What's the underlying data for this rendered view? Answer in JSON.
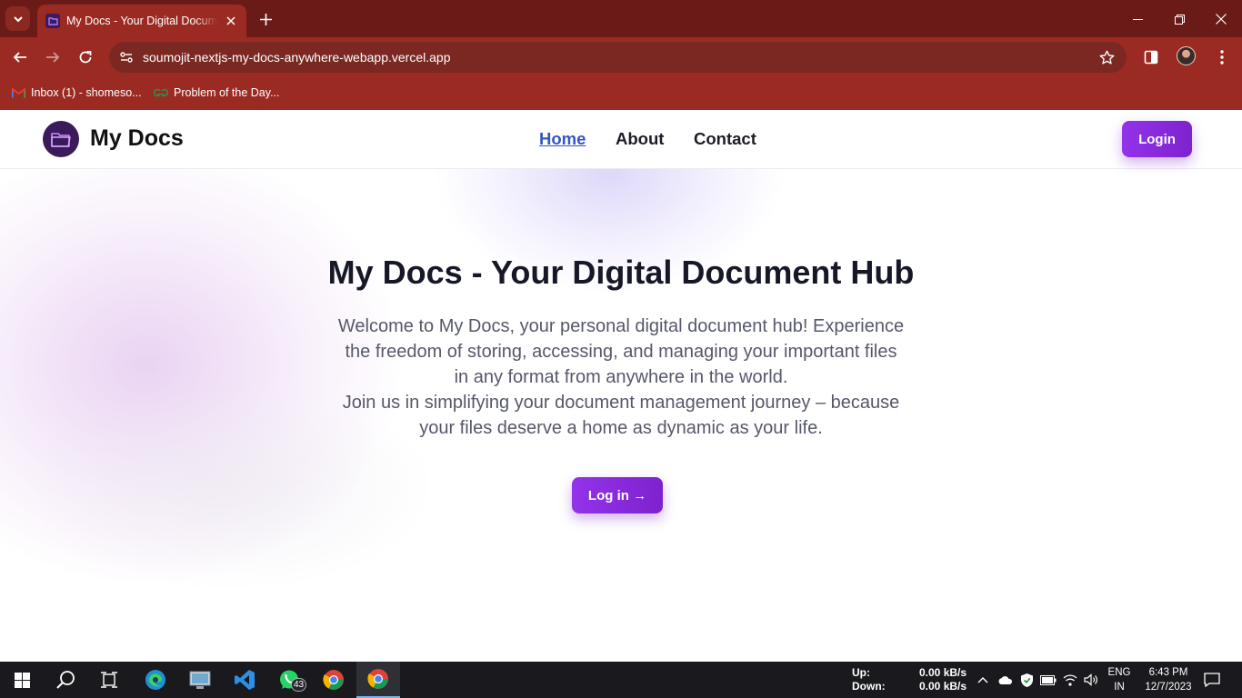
{
  "browser": {
    "tab_title": "My Docs - Your Digital Document Hub",
    "url": "soumojit-nextjs-my-docs-anywhere-webapp.vercel.app",
    "bookmarks": [
      {
        "label": "Inbox (1) - shomeso...",
        "icon": "gmail-icon"
      },
      {
        "label": "Problem of the Day...",
        "icon": "gfg-icon"
      }
    ]
  },
  "site": {
    "brand": "My Docs",
    "nav": {
      "home": "Home",
      "about": "About",
      "contact": "Contact"
    },
    "login_label": "Login",
    "accent_color": "#9333ea"
  },
  "hero": {
    "title": "My Docs - Your Digital Document Hub",
    "paragraph_lines": [
      "Welcome to My Docs, your personal digital document hub! Experience",
      "the freedom of storing, accessing, and managing your important files",
      "in any format from anywhere in the world.",
      "Join us in simplifying your document management journey – because",
      "your files deserve a home as dynamic as your life."
    ],
    "cta_label": "Log in →"
  },
  "taskbar": {
    "whatsapp_badge": "43",
    "net_up_label": "Up:",
    "net_down_label": "Down:",
    "net_up_value": "0.00 kB/s",
    "net_down_value": "0.00 kB/s",
    "lang_line1": "ENG",
    "lang_line2": "IN",
    "time": "6:43 PM",
    "date": "12/7/2023"
  }
}
